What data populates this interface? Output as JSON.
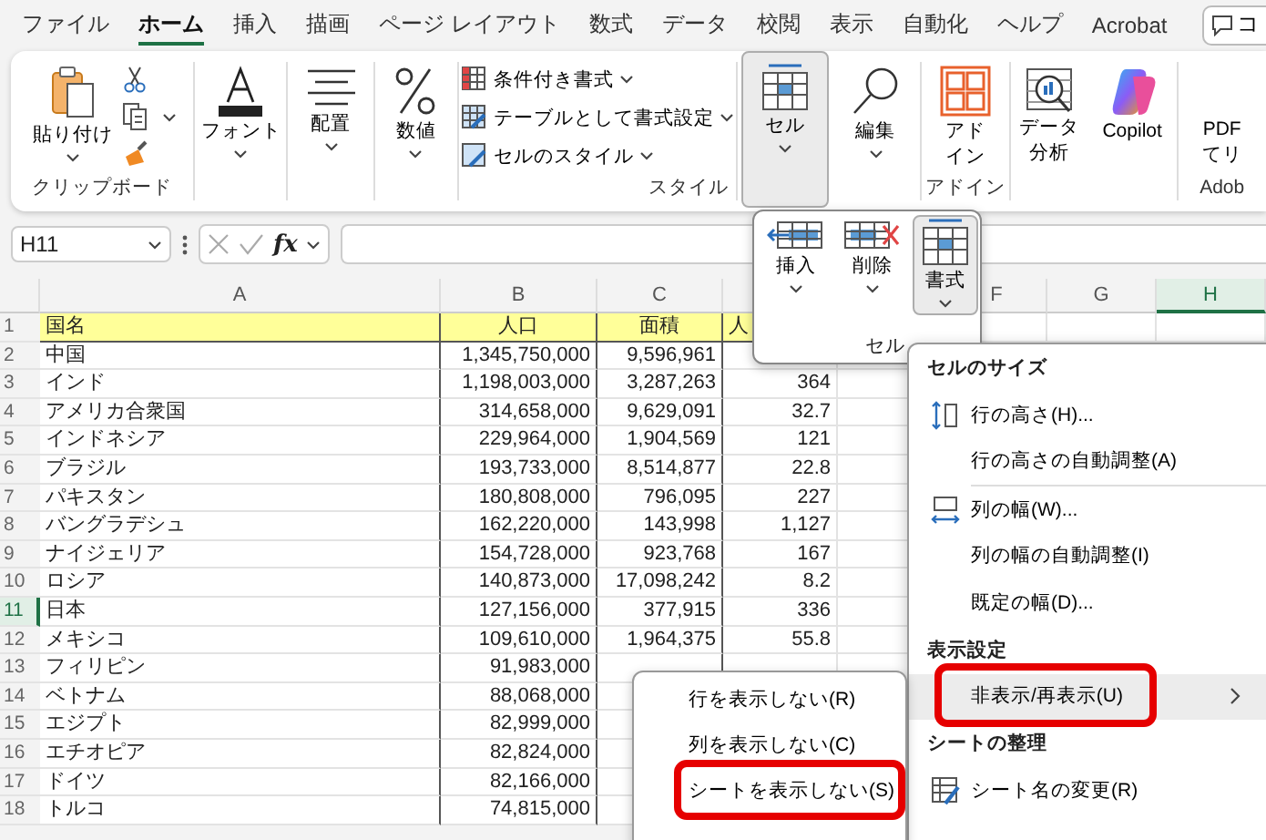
{
  "ribbon_tabs": [
    {
      "label": "ファイル",
      "selected": false
    },
    {
      "label": "ホーム",
      "selected": true
    },
    {
      "label": "挿入",
      "selected": false
    },
    {
      "label": "描画",
      "selected": false
    },
    {
      "label": "ページ レイアウト",
      "selected": false
    },
    {
      "label": "数式",
      "selected": false
    },
    {
      "label": "データ",
      "selected": false
    },
    {
      "label": "校閲",
      "selected": false
    },
    {
      "label": "表示",
      "selected": false
    },
    {
      "label": "自動化",
      "selected": false
    },
    {
      "label": "ヘルプ",
      "selected": false
    },
    {
      "label": "Acrobat",
      "selected": false
    }
  ],
  "comment_button": {
    "label": "コ"
  },
  "ribbon": {
    "clipboard": {
      "paste": "貼り付け",
      "label": "クリップボード"
    },
    "font": "フォント",
    "alignment": "配置",
    "number": "数値",
    "styles": {
      "items": [
        "条件付き書式",
        "テーブルとして書式設定",
        "セルのスタイル"
      ],
      "label": "スタイル"
    },
    "cells": {
      "label": "セル",
      "selected": true
    },
    "editing": "編集",
    "addins": {
      "lines": [
        "アド",
        "イン"
      ],
      "label": "アドイン"
    },
    "data_analysis": {
      "lines": [
        "データ",
        "分析"
      ]
    },
    "copilot": "Copilot",
    "adobe": {
      "lines": [
        "PDF",
        "てリ"
      ],
      "label": "Adob"
    }
  },
  "formula_bar": {
    "name_box": "H11",
    "function_label": "fx"
  },
  "columns": [
    {
      "label": "A",
      "selected": false
    },
    {
      "label": "B",
      "selected": false
    },
    {
      "label": "C",
      "selected": false
    },
    {
      "label": "F",
      "selected": false
    },
    {
      "label": "G",
      "selected": false
    },
    {
      "label": "H",
      "selected": true
    }
  ],
  "rows": [
    {
      "number": "1",
      "kind": "header",
      "selected": false,
      "cells": [
        "国名",
        "人口",
        "面積",
        "人"
      ]
    },
    {
      "number": "2",
      "kind": "data",
      "selected": false,
      "cells": [
        "中国",
        "1,345,750,000",
        "9,596,961"
      ]
    },
    {
      "number": "3",
      "kind": "data",
      "selected": false,
      "cells": [
        "インド",
        "1,198,003,000",
        "3,287,263",
        "364"
      ]
    },
    {
      "number": "4",
      "kind": "data",
      "selected": false,
      "cells": [
        "アメリカ合衆国",
        "314,658,000",
        "9,629,091",
        "32.7"
      ]
    },
    {
      "number": "5",
      "kind": "data",
      "selected": false,
      "cells": [
        "インドネシア",
        "229,964,000",
        "1,904,569",
        "121"
      ]
    },
    {
      "number": "6",
      "kind": "data",
      "selected": false,
      "cells": [
        "ブラジル",
        "193,733,000",
        "8,514,877",
        "22.8"
      ]
    },
    {
      "number": "7",
      "kind": "data",
      "selected": false,
      "cells": [
        "パキスタン",
        "180,808,000",
        "796,095",
        "227"
      ]
    },
    {
      "number": "8",
      "kind": "data",
      "selected": false,
      "cells": [
        "バングラデシュ",
        "162,220,000",
        "143,998",
        "1,127"
      ]
    },
    {
      "number": "9",
      "kind": "data",
      "selected": false,
      "cells": [
        "ナイジェリア",
        "154,728,000",
        "923,768",
        "167"
      ]
    },
    {
      "number": "10",
      "kind": "data",
      "selected": false,
      "cells": [
        "ロシア",
        "140,873,000",
        "17,098,242",
        "8.2"
      ]
    },
    {
      "number": "11",
      "kind": "data",
      "selected": true,
      "cells": [
        "日本",
        "127,156,000",
        "377,915",
        "336"
      ]
    },
    {
      "number": "12",
      "kind": "data",
      "selected": false,
      "cells": [
        "メキシコ",
        "109,610,000",
        "1,964,375",
        "55.8"
      ]
    },
    {
      "number": "13",
      "kind": "data",
      "selected": false,
      "cells": [
        "フィリピン",
        "91,983,000"
      ]
    },
    {
      "number": "14",
      "kind": "data",
      "selected": false,
      "cells": [
        "ベトナム",
        "88,068,000"
      ]
    },
    {
      "number": "15",
      "kind": "data",
      "selected": false,
      "cells": [
        "エジプト",
        "82,999,000"
      ]
    },
    {
      "number": "16",
      "kind": "data",
      "selected": false,
      "cells": [
        "エチオピア",
        "82,824,000"
      ]
    },
    {
      "number": "17",
      "kind": "data",
      "selected": false,
      "cells": [
        "ドイツ",
        "82,166,000"
      ]
    },
    {
      "number": "18",
      "kind": "data",
      "selected": false,
      "cells": [
        "トルコ",
        "74,815,000"
      ]
    }
  ],
  "cells_popup": {
    "buttons": [
      {
        "label": "挿入",
        "selected": false
      },
      {
        "label": "削除",
        "selected": false
      },
      {
        "label": "書式",
        "selected": true
      }
    ],
    "label": "セル"
  },
  "format_menu": {
    "items": [
      {
        "kind": "header",
        "label": "セルのサイズ"
      },
      {
        "kind": "item",
        "label": "行の高さ(H)...",
        "icon": true
      },
      {
        "kind": "item",
        "label": "行の高さの自動調整(A)"
      },
      {
        "kind": "separator"
      },
      {
        "kind": "item",
        "label": "列の幅(W)...",
        "icon": true
      },
      {
        "kind": "item",
        "label": "列の幅の自動調整(I)"
      },
      {
        "kind": "item",
        "label": "既定の幅(D)..."
      },
      {
        "kind": "header",
        "label": "表示設定"
      },
      {
        "kind": "submenu",
        "label": "非表示/再表示(U)",
        "selected": true,
        "annotated": true
      },
      {
        "kind": "header",
        "label": "シートの整理"
      },
      {
        "kind": "item",
        "label": "シート名の変更(R)",
        "icon": true
      }
    ]
  },
  "hide_submenu": {
    "items": [
      {
        "label": "行を表示しない(R)",
        "annotated": false
      },
      {
        "label": "列を表示しない(C)",
        "annotated": false
      },
      {
        "label": "シートを表示しない(S)",
        "annotated": true
      }
    ]
  }
}
